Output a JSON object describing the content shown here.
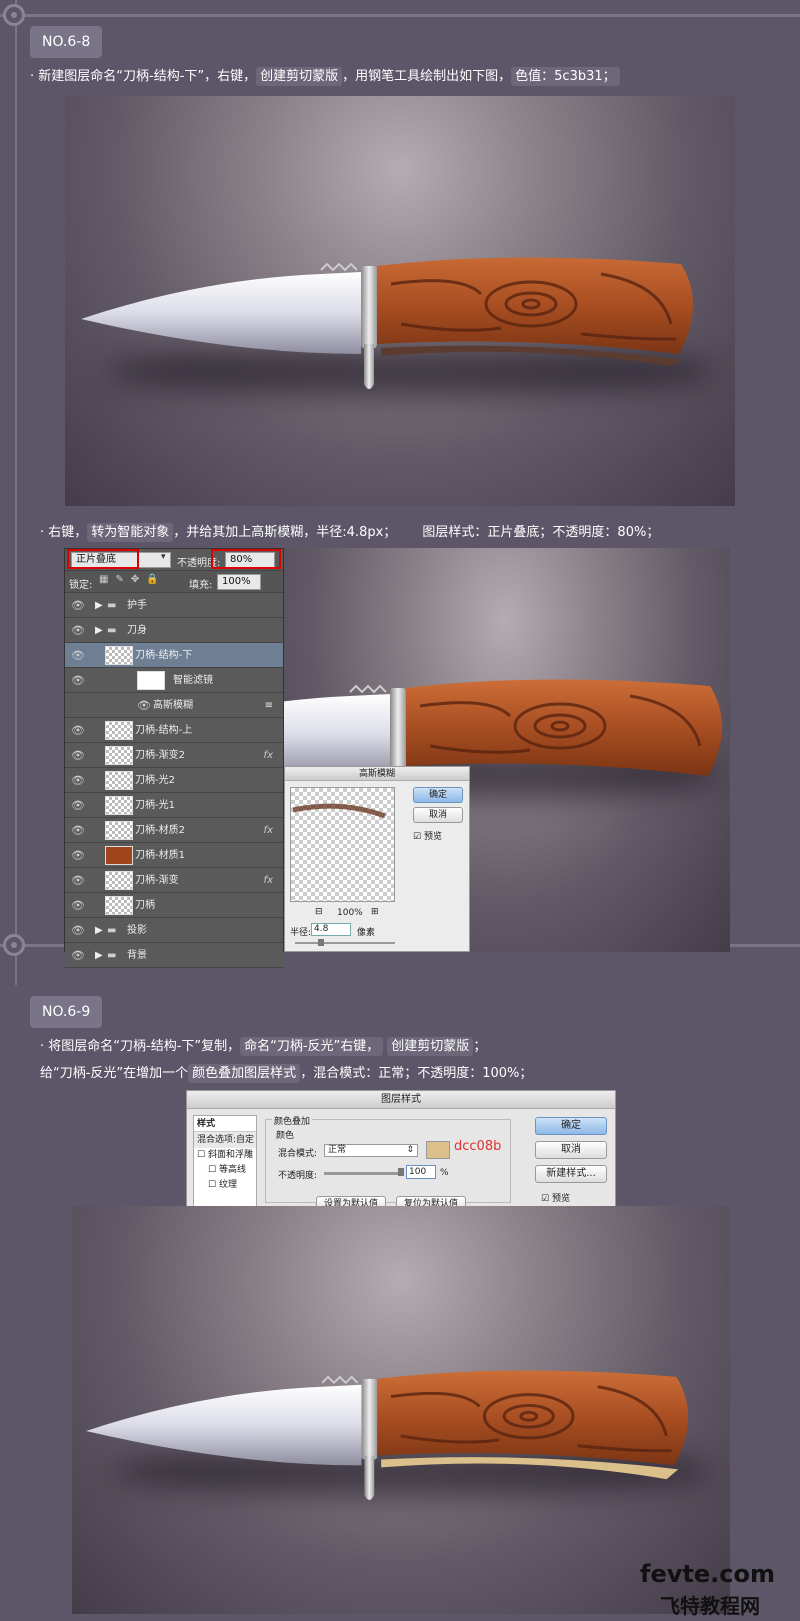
{
  "step1": {
    "badge": "NO.6-8",
    "instruction_parts": [
      "· 新建图层命名“刀柄-结构-下”，右键，",
      "创建剪切蒙版",
      "，用钢笔工具绘制出如下图，",
      "色值：5c3b31；"
    ],
    "color": "#5c3b31"
  },
  "step2": {
    "instruction_a": "· 右键，",
    "instruction_hl": "转为智能对象",
    "instruction_b": "，并给其加上高斯模糊，半径:4.8px；",
    "instruction_c": "图层样式：正片叠底；不透明度：80%；",
    "panel": {
      "blend_mode": "正片叠底",
      "opacity_label": "不透明度:",
      "opacity_value": "80%",
      "lock_label": "锁定:",
      "fill_label": "填充:",
      "fill_value": "100%",
      "layers": [
        {
          "name": "护手",
          "type": "group"
        },
        {
          "name": "刀身",
          "type": "group"
        },
        {
          "name": "刀柄-结构-下",
          "type": "layer",
          "selected": true
        },
        {
          "name": "智能滤镜",
          "type": "filter"
        },
        {
          "name": "高斯模糊",
          "type": "subfilter"
        },
        {
          "name": "刀柄-结构-上",
          "type": "layer"
        },
        {
          "name": "刀柄-渐变2",
          "type": "layer",
          "fx": "fx"
        },
        {
          "name": "刀柄-光2",
          "type": "layer"
        },
        {
          "name": "刀柄-光1",
          "type": "layer"
        },
        {
          "name": "刀柄-材质2",
          "type": "layer",
          "fx": "fx"
        },
        {
          "name": "刀柄-材质1",
          "type": "layer"
        },
        {
          "name": "刀柄-渐变",
          "type": "layer",
          "fx": "fx"
        },
        {
          "name": "刀柄",
          "type": "layer"
        },
        {
          "name": "投影",
          "type": "group"
        },
        {
          "name": "背景",
          "type": "group"
        }
      ]
    },
    "blur_dialog": {
      "title": "高斯模糊",
      "ok": "确定",
      "cancel": "取消",
      "preview": "预览",
      "zoom": "100%",
      "radius_label": "半径:",
      "radius_value": "4.8",
      "unit": "像素"
    }
  },
  "step3": {
    "badge": "NO.6-9",
    "line1_a": "· 将图层命名“刀柄-结构-下”复制，",
    "line1_b": "命名“刀柄-反光”右键，",
    "line1_hl": "创建剪切蒙版",
    "line1_end": "；",
    "line2_a": "给“刀柄-反光”在增加一个",
    "line2_hl": "颜色叠加图层样式",
    "line2_b": "，混合模式：正常；不透明度：100%；",
    "dialog": {
      "title": "图层样式",
      "side_header": "样式",
      "side_items": [
        "混合选项:自定",
        "斜面和浮雕",
        "等高线",
        "纹理"
      ],
      "section": "颜色叠加",
      "subsection": "颜色",
      "blend_label": "混合模式:",
      "blend_value": "正常",
      "opacity_label": "不透明度:",
      "opacity_value": "100",
      "percent": "%",
      "color_code": "dcc08b",
      "swatch": "#dcc08b",
      "ok": "确定",
      "cancel": "取消",
      "new_style": "新建样式...",
      "preview": "预览",
      "btn_default": "设置为默认值",
      "btn_reset": "复位为默认值"
    }
  },
  "watermark": {
    "line1": "fevte.com",
    "line2": "飞特教程网"
  }
}
